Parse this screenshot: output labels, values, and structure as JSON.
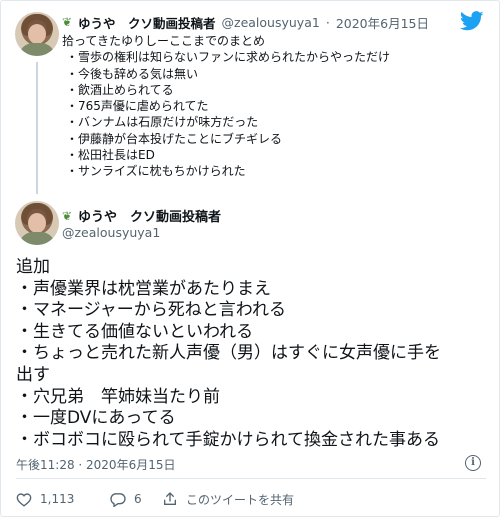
{
  "parent_tweet": {
    "display_name": "ゆうや　クソ動画投稿者",
    "handle": "@zealousyuya1",
    "separator": "·",
    "date": "2020年6月15日",
    "lines": [
      "拾ってきたゆりしーここまでのまとめ",
      "・雪歩の権利は知らないファンに求められたからやっただけ",
      "・今後も辞める気は無い",
      "・飲酒止められてる",
      "・765声優に虐められてた",
      "・バンナムは石原だけが味方だった",
      "・伊藤静が台本投げたことにブチギレる",
      "・松田社長はED",
      "・サンライズに枕もちかけられた"
    ]
  },
  "reply_tweet": {
    "display_name": "ゆうや　クソ動画投稿者",
    "handle": "@zealousyuya1",
    "lines": [
      "追加",
      "・声優業界は枕営業があたりまえ",
      "・マネージャーから死ねと言われる",
      "・生きてる価値ないといわれる",
      "・ちょっと売れた新人声優（男）はすぐに女声優に手を",
      "出す",
      "・穴兄弟　竿姉妹当たり前",
      "・一度DVにあってる",
      "・ボコボコに殴られて手錠かけられて換金された事ある"
    ],
    "timestamp": "午後11:28 · 2020年6月15日"
  },
  "actions": {
    "likes": "1,113",
    "replies": "6",
    "share_label": "このツイートを共有"
  },
  "icons": {
    "brand": "twitter-bird-icon",
    "info": "info-icon",
    "like": "heart-icon",
    "reply": "reply-icon",
    "share": "share-icon"
  },
  "colors": {
    "brand_blue": "#1da1f2",
    "text": "#0f1419",
    "secondary": "#536471",
    "border": "#e1e8ed"
  }
}
